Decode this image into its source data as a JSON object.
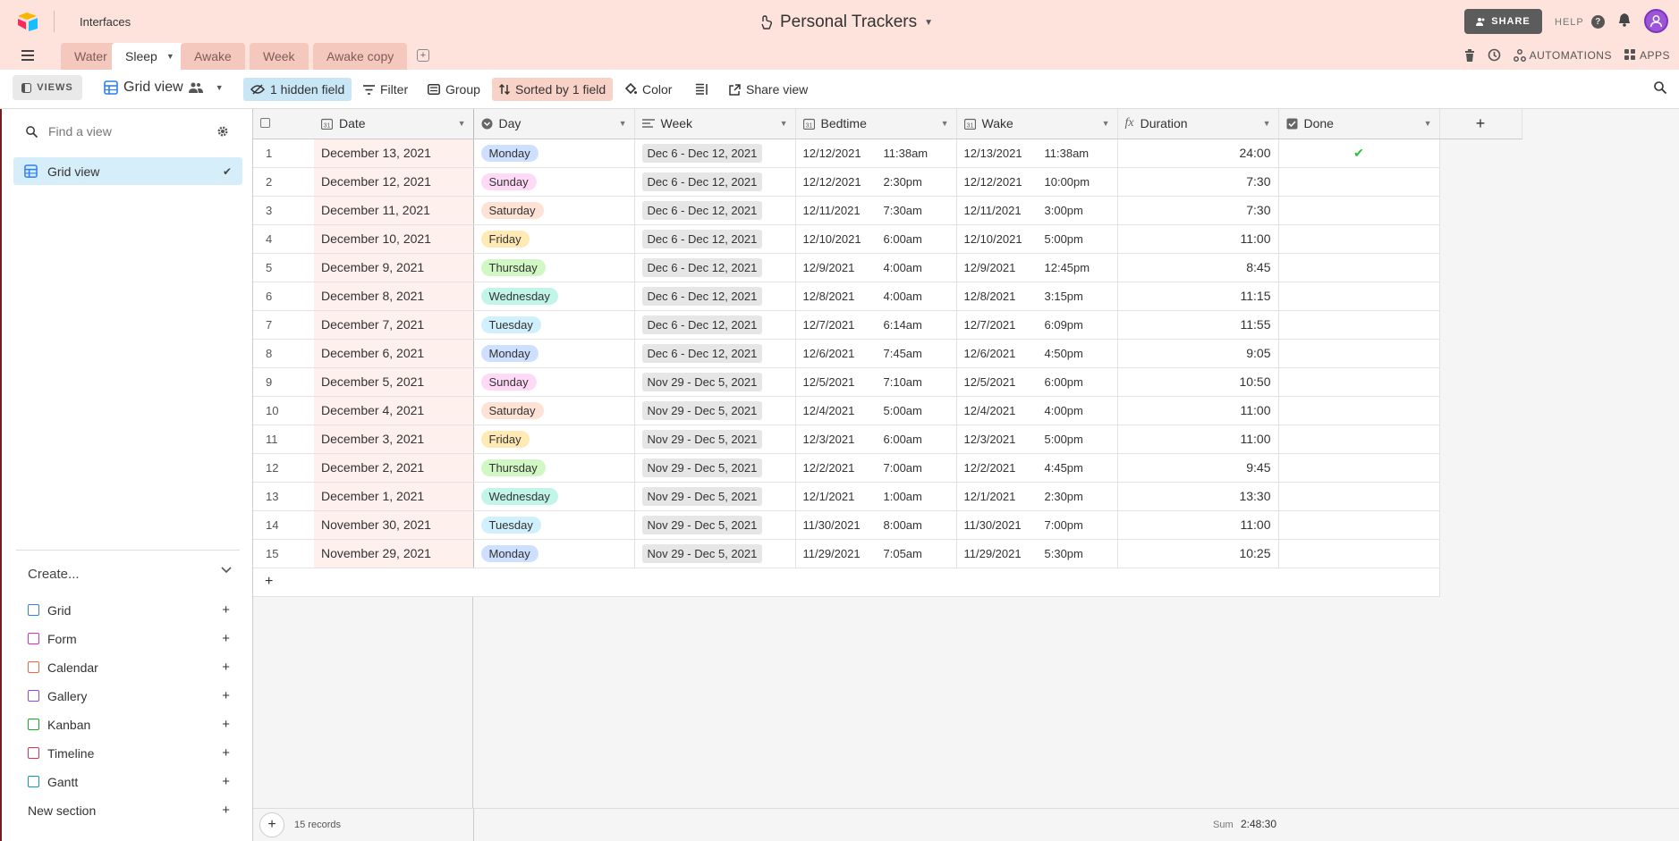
{
  "header": {
    "interfaces_label": "Interfaces",
    "base_title": "Personal Trackers",
    "share_label": "SHARE",
    "help_label": "HELP"
  },
  "tabs": [
    {
      "label": "Water",
      "active": false
    },
    {
      "label": "Sleep",
      "active": true
    },
    {
      "label": "Awake",
      "active": false
    },
    {
      "label": "Week",
      "active": false
    },
    {
      "label": "Awake copy",
      "active": false
    }
  ],
  "right_tools": {
    "automations": "AUTOMATIONS",
    "apps": "APPS"
  },
  "viewbar": {
    "views_label": "VIEWS",
    "view_name": "Grid view",
    "hidden_fields": "1 hidden field",
    "filter": "Filter",
    "group": "Group",
    "sorted": "Sorted by 1 field",
    "color": "Color",
    "share_view": "Share view"
  },
  "sidebar": {
    "find_placeholder": "Find a view",
    "selected_view": "Grid view",
    "create_label": "Create...",
    "create_items": [
      {
        "label": "Grid",
        "color": "#2d7ff9"
      },
      {
        "label": "Form",
        "color": "#e929ba"
      },
      {
        "label": "Calendar",
        "color": "#f7653b"
      },
      {
        "label": "Gallery",
        "color": "#8b46ff"
      },
      {
        "label": "Kanban",
        "color": "#11af22"
      },
      {
        "label": "Timeline",
        "color": "#e4304f"
      },
      {
        "label": "Gantt",
        "color": "#0f9aa8"
      },
      {
        "label": "New section",
        "color": ""
      }
    ]
  },
  "columns": {
    "date": "Date",
    "day": "Day",
    "week": "Week",
    "bedtime": "Bedtime",
    "wake": "Wake",
    "duration": "Duration",
    "done": "Done"
  },
  "day_colors": {
    "Monday": "#cfdfff",
    "Sunday": "#ffdaf6",
    "Saturday": "#fee2d5",
    "Friday": "#ffeab6",
    "Thursday": "#d1f7c4",
    "Wednesday": "#c2f5e9",
    "Tuesday": "#d0f0fd"
  },
  "rows": [
    {
      "n": "1",
      "date": "December 13, 2021",
      "day": "Monday",
      "week": "Dec 6 - Dec 12, 2021",
      "bed_date": "12/12/2021",
      "bed_time": "11:38am",
      "wake_date": "12/13/2021",
      "wake_time": "11:38am",
      "duration": "24:00",
      "done": true
    },
    {
      "n": "2",
      "date": "December 12, 2021",
      "day": "Sunday",
      "week": "Dec 6 - Dec 12, 2021",
      "bed_date": "12/12/2021",
      "bed_time": "2:30pm",
      "wake_date": "12/12/2021",
      "wake_time": "10:00pm",
      "duration": "7:30",
      "done": false
    },
    {
      "n": "3",
      "date": "December 11, 2021",
      "day": "Saturday",
      "week": "Dec 6 - Dec 12, 2021",
      "bed_date": "12/11/2021",
      "bed_time": "7:30am",
      "wake_date": "12/11/2021",
      "wake_time": "3:00pm",
      "duration": "7:30",
      "done": false
    },
    {
      "n": "4",
      "date": "December 10, 2021",
      "day": "Friday",
      "week": "Dec 6 - Dec 12, 2021",
      "bed_date": "12/10/2021",
      "bed_time": "6:00am",
      "wake_date": "12/10/2021",
      "wake_time": "5:00pm",
      "duration": "11:00",
      "done": false
    },
    {
      "n": "5",
      "date": "December 9, 2021",
      "day": "Thursday",
      "week": "Dec 6 - Dec 12, 2021",
      "bed_date": "12/9/2021",
      "bed_time": "4:00am",
      "wake_date": "12/9/2021",
      "wake_time": "12:45pm",
      "duration": "8:45",
      "done": false
    },
    {
      "n": "6",
      "date": "December 8, 2021",
      "day": "Wednesday",
      "week": "Dec 6 - Dec 12, 2021",
      "bed_date": "12/8/2021",
      "bed_time": "4:00am",
      "wake_date": "12/8/2021",
      "wake_time": "3:15pm",
      "duration": "11:15",
      "done": false
    },
    {
      "n": "7",
      "date": "December 7, 2021",
      "day": "Tuesday",
      "week": "Dec 6 - Dec 12, 2021",
      "bed_date": "12/7/2021",
      "bed_time": "6:14am",
      "wake_date": "12/7/2021",
      "wake_time": "6:09pm",
      "duration": "11:55",
      "done": false
    },
    {
      "n": "8",
      "date": "December 6, 2021",
      "day": "Monday",
      "week": "Dec 6 - Dec 12, 2021",
      "bed_date": "12/6/2021",
      "bed_time": "7:45am",
      "wake_date": "12/6/2021",
      "wake_time": "4:50pm",
      "duration": "9:05",
      "done": false
    },
    {
      "n": "9",
      "date": "December 5, 2021",
      "day": "Sunday",
      "week": "Nov 29 - Dec 5, 2021",
      "bed_date": "12/5/2021",
      "bed_time": "7:10am",
      "wake_date": "12/5/2021",
      "wake_time": "6:00pm",
      "duration": "10:50",
      "done": false
    },
    {
      "n": "10",
      "date": "December 4, 2021",
      "day": "Saturday",
      "week": "Nov 29 - Dec 5, 2021",
      "bed_date": "12/4/2021",
      "bed_time": "5:00am",
      "wake_date": "12/4/2021",
      "wake_time": "4:00pm",
      "duration": "11:00",
      "done": false
    },
    {
      "n": "11",
      "date": "December 3, 2021",
      "day": "Friday",
      "week": "Nov 29 - Dec 5, 2021",
      "bed_date": "12/3/2021",
      "bed_time": "6:00am",
      "wake_date": "12/3/2021",
      "wake_time": "5:00pm",
      "duration": "11:00",
      "done": false
    },
    {
      "n": "12",
      "date": "December 2, 2021",
      "day": "Thursday",
      "week": "Nov 29 - Dec 5, 2021",
      "bed_date": "12/2/2021",
      "bed_time": "7:00am",
      "wake_date": "12/2/2021",
      "wake_time": "4:45pm",
      "duration": "9:45",
      "done": false
    },
    {
      "n": "13",
      "date": "December 1, 2021",
      "day": "Wednesday",
      "week": "Nov 29 - Dec 5, 2021",
      "bed_date": "12/1/2021",
      "bed_time": "1:00am",
      "wake_date": "12/1/2021",
      "wake_time": "2:30pm",
      "duration": "13:30",
      "done": false
    },
    {
      "n": "14",
      "date": "November 30, 2021",
      "day": "Tuesday",
      "week": "Nov 29 - Dec 5, 2021",
      "bed_date": "11/30/2021",
      "bed_time": "8:00am",
      "wake_date": "11/30/2021",
      "wake_time": "7:00pm",
      "duration": "11:00",
      "done": false
    },
    {
      "n": "15",
      "date": "November 29, 2021",
      "day": "Monday",
      "week": "Nov 29 - Dec 5, 2021",
      "bed_date": "11/29/2021",
      "bed_time": "7:05am",
      "wake_date": "11/29/2021",
      "wake_time": "5:30pm",
      "duration": "10:25",
      "done": false
    }
  ],
  "footer": {
    "records": "15 records",
    "sum_label": "Sum",
    "sum_value": "2:48:30"
  }
}
